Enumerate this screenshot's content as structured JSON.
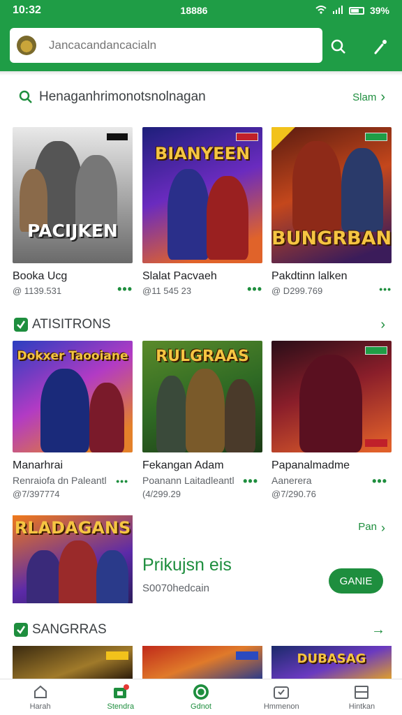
{
  "status_bar": {
    "time": "10:32",
    "center": "18886",
    "battery": "39%"
  },
  "search": {
    "placeholder": "Jancacandancacialn"
  },
  "section1": {
    "title": "Henaganhrimonotsnolnagan",
    "link": "Slam",
    "cards": [
      {
        "name": "Booka Ucg",
        "meta": "@ 1139.531",
        "art": "PACIJKEN"
      },
      {
        "name": "Slalat Pacvaeh",
        "meta": "@11 545 23",
        "art": "BIANYEEN"
      },
      {
        "name": "Pakdtinn lalken",
        "meta": "@ D299.769",
        "art": "BUNGRBAN"
      }
    ]
  },
  "section2": {
    "title": "ATISITRONS",
    "cards": [
      {
        "name": "Manarhrai",
        "sub": "Renraiofa dn Paleantl",
        "meta": "@7/397774",
        "art": "Dokxer Taooiane"
      },
      {
        "name": "Fekangan Adam",
        "sub": "Poanann Laitadleantl",
        "meta": "(4/299.29",
        "art": "RULGRAAS"
      },
      {
        "name": "Papanalmadme",
        "sub": "Aanerera",
        "meta": "@7/290.76",
        "art": ""
      }
    ]
  },
  "promo": {
    "art": "RLADAGANS",
    "link": "Pan",
    "title": "Prikujsn eis",
    "sub": "S0070hedcain",
    "button": "GANIE"
  },
  "section3": {
    "title": "SANGRRAS",
    "art3": "DUBASAG"
  },
  "bottom_nav": [
    {
      "label": "Harah"
    },
    {
      "label": "Stendra"
    },
    {
      "label": "Gdnot"
    },
    {
      "label": "Hmmenon"
    },
    {
      "label": "Hintkan"
    }
  ],
  "colors": {
    "brand": "#1f9d46",
    "accent": "#1e8e3e"
  }
}
